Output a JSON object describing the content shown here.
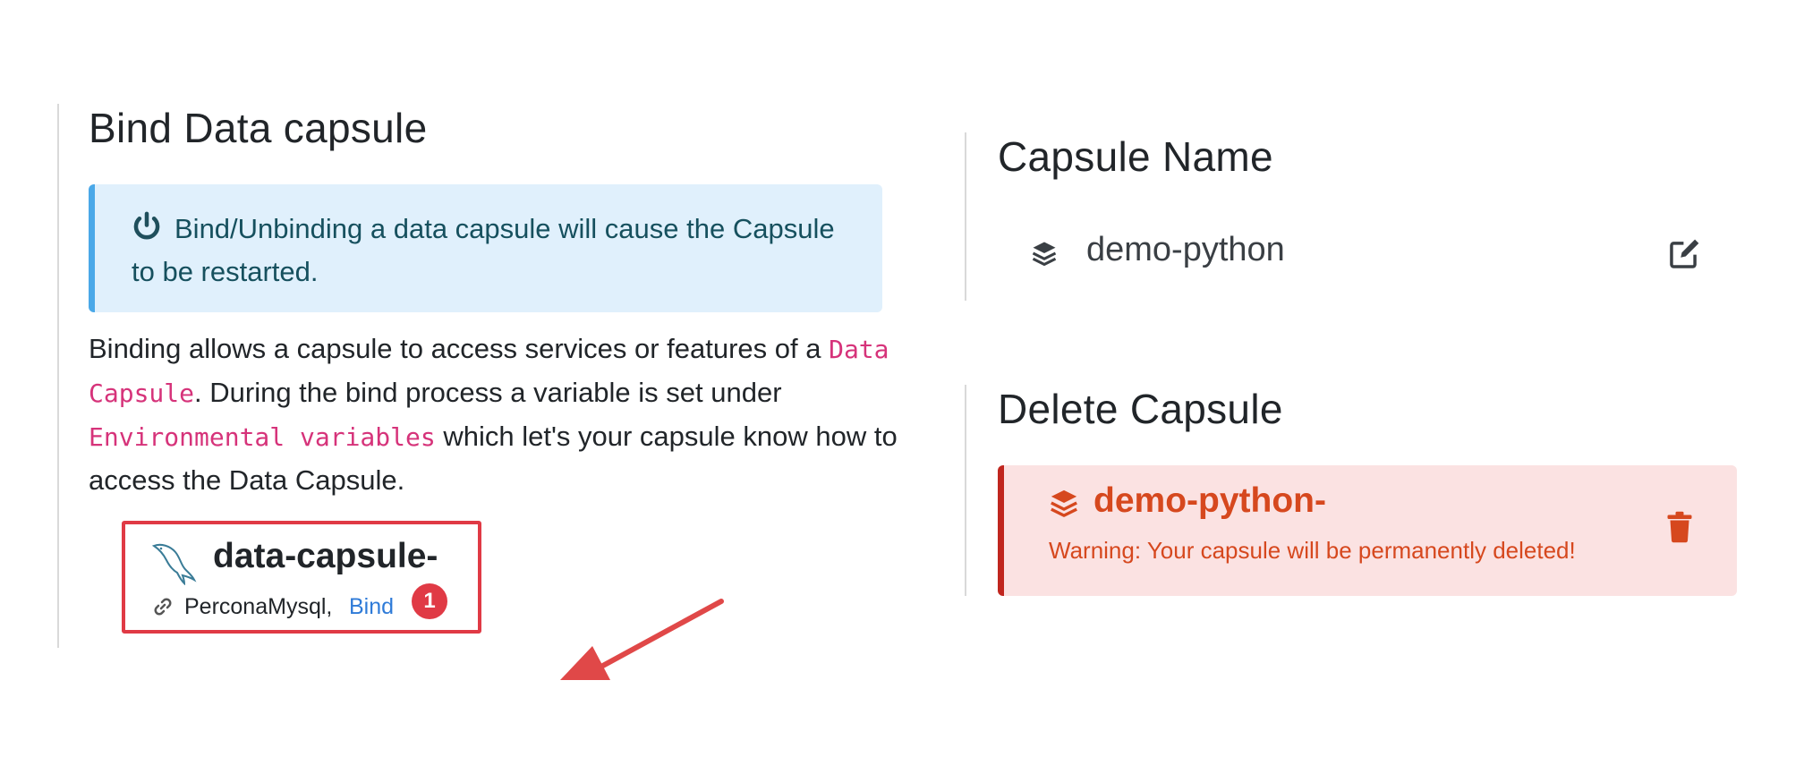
{
  "bind_section": {
    "title": "Bind Data capsule",
    "info_text": "Bind/Unbinding a data capsule will cause the Capsule to be restarted.",
    "description_part1": "Binding allows a capsule to access services or features of a ",
    "description_code1": "Data Capsule",
    "description_part2": ". During the bind process a variable is set under ",
    "description_code2": "Environmental variables",
    "description_part3": " which let's your capsule know how to access the Data Capsule.",
    "card": {
      "title": "data-capsule-",
      "service": "PerconaMysql,",
      "bind_label": "Bind",
      "badge": "1"
    }
  },
  "name_section": {
    "title": "Capsule Name",
    "capsule_name": "demo-python"
  },
  "delete_section": {
    "title": "Delete Capsule",
    "capsule_name": "demo-python-",
    "warning": "Warning: Your capsule will be permanently deleted!"
  },
  "colors": {
    "info_bg": "#e0f0fc",
    "info_border": "#4aa8e8",
    "danger_bg": "#fbe2e2",
    "danger_border": "#c0261e",
    "danger_text": "#d6481e",
    "highlight": "#e03a45",
    "link": "#2f7bd8",
    "code": "#d6337a"
  },
  "icons": [
    "power-icon",
    "mysql-dolphin-icon",
    "link-icon",
    "layers-icon",
    "edit-icon",
    "trash-icon",
    "arrow-annotation"
  ]
}
